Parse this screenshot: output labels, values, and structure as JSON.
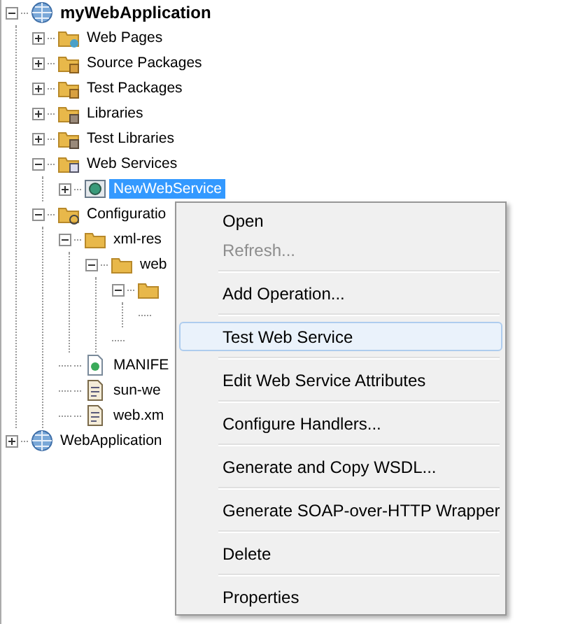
{
  "tree": [
    {
      "label": "myWebApplication",
      "kind": "globe",
      "expanded": true,
      "selected": false,
      "bold": true,
      "children": [
        {
          "label": "Web Pages",
          "kind": "webfolder",
          "expanded": false,
          "selected": false
        },
        {
          "label": "Source Packages",
          "kind": "packagefolder",
          "expanded": false,
          "selected": false
        },
        {
          "label": "Test Packages",
          "kind": "packagefolder",
          "expanded": false,
          "selected": false
        },
        {
          "label": "Libraries",
          "kind": "libraryfolder",
          "expanded": false,
          "selected": false
        },
        {
          "label": "Test Libraries",
          "kind": "libraryfolder",
          "expanded": false,
          "selected": false
        },
        {
          "label": "Web Services",
          "kind": "servicefolder",
          "expanded": true,
          "selected": false,
          "children": [
            {
              "label": "NewWebService",
              "kind": "service",
              "expanded": false,
              "selected": true
            }
          ]
        },
        {
          "label": "Configuratio",
          "kind": "configfolder",
          "expanded": true,
          "selected": false,
          "children": [
            {
              "label": "xml-res",
              "kind": "folder",
              "expanded": true,
              "selected": false,
              "children": [
                {
                  "label": "web",
                  "kind": "folder",
                  "expanded": true,
                  "selected": false,
                  "children": [
                    {
                      "kind": "folder",
                      "expanded": true
                    }
                  ]
                }
              ]
            },
            {
              "label": "MANIFE",
              "kind": "manifest",
              "selected": false
            },
            {
              "label": "sun-we",
              "kind": "xml",
              "selected": false
            },
            {
              "label": "web.xm",
              "kind": "xml",
              "selected": false
            }
          ]
        }
      ]
    },
    {
      "label": "WebApplication",
      "kind": "globe",
      "expanded": false,
      "selected": false,
      "bold": false
    }
  ],
  "context_menu": [
    {
      "kind": "item",
      "label": "Open",
      "disabled": false,
      "highlighted": false
    },
    {
      "kind": "item",
      "label": "Refresh...",
      "disabled": true,
      "highlighted": false
    },
    {
      "kind": "separator"
    },
    {
      "kind": "item",
      "label": "Add Operation...",
      "disabled": false,
      "highlighted": false
    },
    {
      "kind": "separator"
    },
    {
      "kind": "item",
      "label": "Test Web Service",
      "disabled": false,
      "highlighted": true
    },
    {
      "kind": "separator"
    },
    {
      "kind": "item",
      "label": "Edit Web Service Attributes",
      "disabled": false,
      "highlighted": false
    },
    {
      "kind": "separator"
    },
    {
      "kind": "item",
      "label": "Configure Handlers...",
      "disabled": false,
      "highlighted": false
    },
    {
      "kind": "separator"
    },
    {
      "kind": "item",
      "label": "Generate and Copy WSDL...",
      "disabled": false,
      "highlighted": false
    },
    {
      "kind": "separator"
    },
    {
      "kind": "item",
      "label": "Generate SOAP-over-HTTP Wrapper",
      "disabled": false,
      "highlighted": false
    },
    {
      "kind": "separator"
    },
    {
      "kind": "item",
      "label": "Delete",
      "disabled": false,
      "highlighted": false
    },
    {
      "kind": "separator"
    },
    {
      "kind": "item",
      "label": "Properties",
      "disabled": false,
      "highlighted": false
    }
  ]
}
